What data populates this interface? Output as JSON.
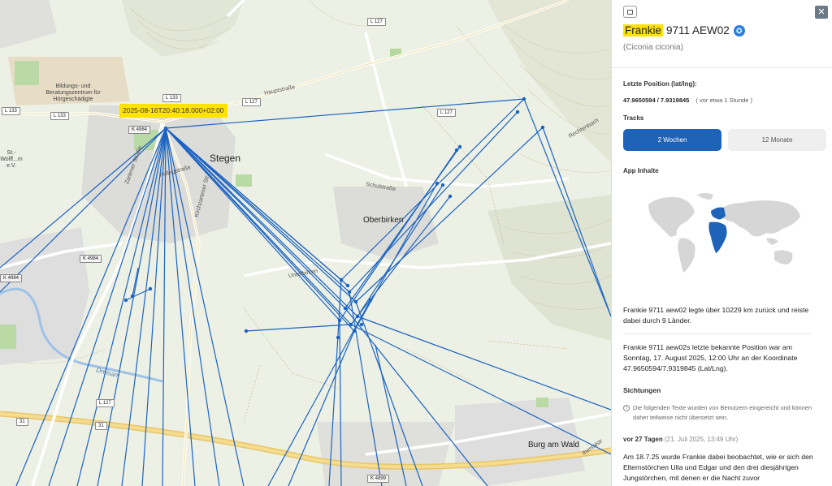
{
  "map": {
    "timestamp_label": "2025-08-16T20:40:18.000+02:00",
    "labels": {
      "stegen": "Stegen",
      "oberbirken": "Oberbirken",
      "burg_am_wald": "Burg am Wald",
      "hauptstrasse": "Hauptstraße",
      "schulstrasse": "Schulstraße",
      "unterbirken": "Unterbirken",
      "rechtenbach": "Rechtenbach",
      "ibentalstrasse": "Ibentalstr",
      "kirchzartener": "Kirchzartener Str.",
      "zarten": "Zartener Straße",
      "kollegstrasse": "Kollegstraße",
      "dreisam": "Dreisam",
      "bildungs": "Bildungs- und Beratungszentrum für Hörgeschädigte",
      "wolff": "St.-Wolff...m e.V."
    },
    "road_shields": [
      "L 133",
      "L 133",
      "L 133",
      "L 127",
      "L 127",
      "L 127",
      "K 4984",
      "K 4984",
      "K 4984",
      "L 127",
      "31",
      "31",
      "K 4899"
    ]
  },
  "panel": {
    "bird_name": "Frankie",
    "bird_id": "9711 AEW02",
    "scientific_name": "(Ciconia ciconia)",
    "last_position_label": "Letzte Position (lat/lng):",
    "last_position_value": "47.9650594 / 7.9319845",
    "last_position_ago": "( vor etwa 1 Stunde )",
    "tracks_label": "Tracks",
    "tab_2weeks": "2 Wochen",
    "tab_12months": "12 Monate",
    "app_contents_label": "App Inhalte",
    "summary_text": "Frankie 9711 aew02 legte über 10229 km zurück und reiste dabei durch 9 Länder.",
    "last_known_text": "Frankie 9711 aew02s letzte bekannte Position war am Sonntag, 17. August 2025, 12:00 Uhr an der Koordinate 47.9650594/7.9319845 (Lat/Lng).",
    "sightings_label": "Sichtungen",
    "sightings_note": "Die folgenden Texte wurden von Benutzern eingereicht und können daher teilweise nicht übersetzt sein.",
    "sighting_ago": "vor 27 Tagen",
    "sighting_date": "(21. Juli 2025, 13:49 Uhr)",
    "sighting_text": "Am 18.7.25 wurde Frankie dabei beobachtet, wie er sich den Elternstörchen Ulla und Edgar und den drei diesjährigen Jungstörchen, mit denen er die Nacht zuvor"
  },
  "colors": {
    "track": "#1a63c4",
    "highlight": "#ffe300",
    "primary_button": "#1e63b8"
  },
  "icons": {
    "sidebar": "sidebar-toggle-icon",
    "close": "close-icon",
    "verified": "verified-star-icon",
    "info": "info-icon"
  }
}
